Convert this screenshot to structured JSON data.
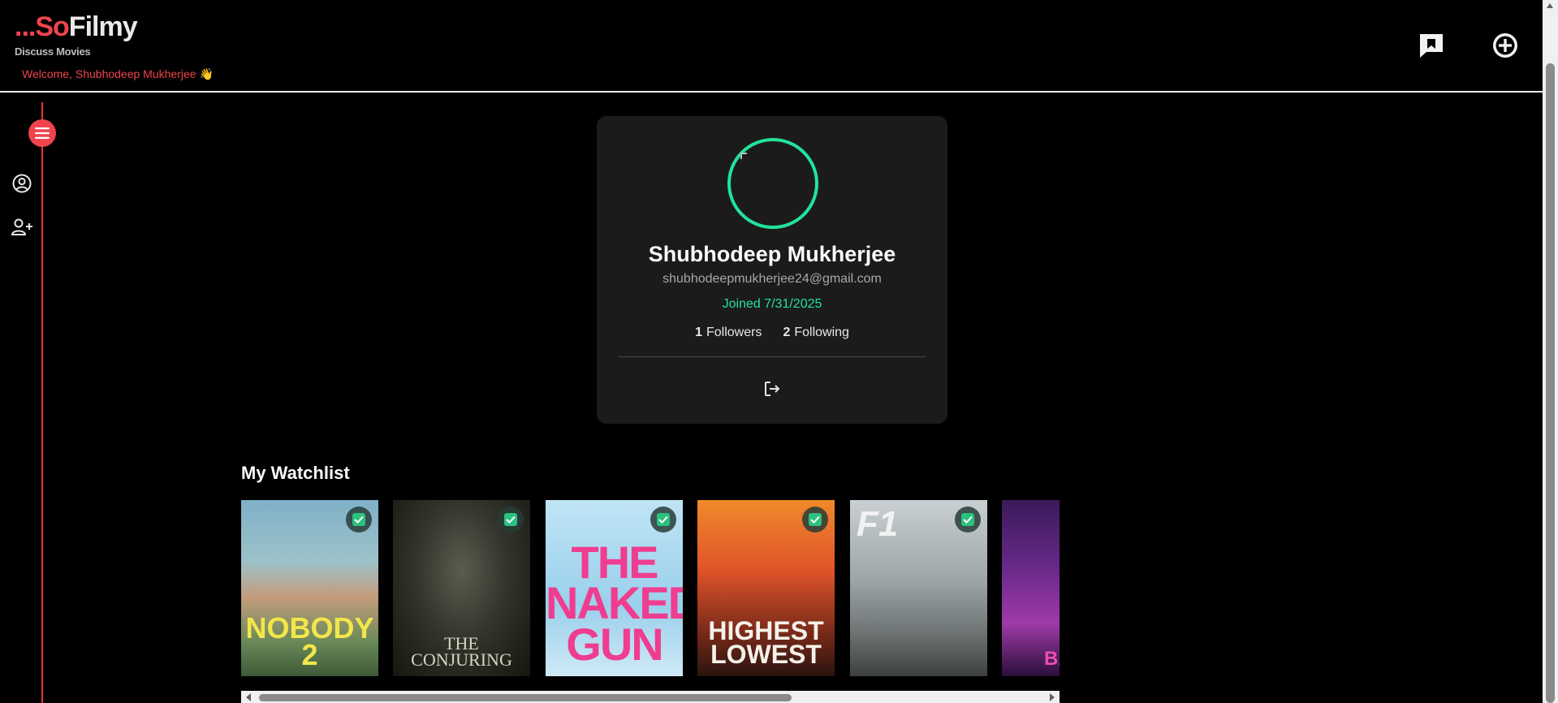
{
  "header": {
    "logo_dots": "...",
    "logo_so": "So",
    "logo_filmy": "Filmy",
    "tagline": "Discuss Movies",
    "welcome": "Welcome, Shubhodeep Mukherjee",
    "welcome_emoji": "👋",
    "icons": [
      "discussions-icon",
      "add-circle-icon"
    ]
  },
  "sidebar": {
    "items": [
      "menu-icon",
      "profile-icon",
      "add-user-icon"
    ]
  },
  "profile": {
    "name": "Shubhodeep Mukherjee",
    "email": "shubhodeepmukherjee24@gmail.com",
    "joined": "Joined 7/31/2025",
    "followers_count": "1",
    "followers_label": "Followers",
    "following_count": "2",
    "following_label": "Following",
    "logout_icon": "logout-icon"
  },
  "watchlist": {
    "title": "My Watchlist",
    "items": [
      {
        "title": "NOBODY 2",
        "watched": true
      },
      {
        "title": "THE CONJURING",
        "watched": true
      },
      {
        "title": "THE NAKED GUN",
        "watched": true
      },
      {
        "title": "HIGHEST LOWEST",
        "watched": true
      },
      {
        "title": "F1",
        "watched": true
      },
      {
        "title": "BAL",
        "watched": false
      }
    ]
  },
  "colors": {
    "brand_red": "#f0444c",
    "accent_green": "#22e39a",
    "card_bg": "#1b1b1b",
    "check_green": "#2bc17e"
  }
}
